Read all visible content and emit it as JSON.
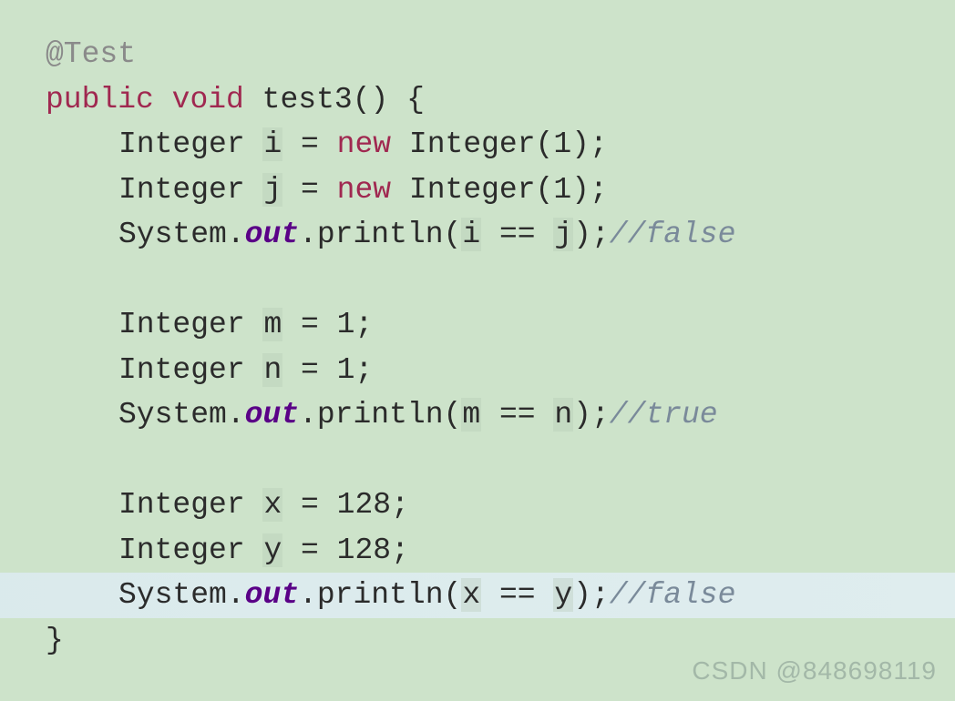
{
  "code": {
    "annotation": "@Test",
    "kw_public": "public",
    "kw_void": "void",
    "method_name": "test3",
    "brace_open": "{",
    "brace_close": "}",
    "type_integer": "Integer",
    "var_i": "i",
    "var_j": "j",
    "var_m": "m",
    "var_n": "n",
    "var_x": "x",
    "var_y": "y",
    "kw_new": "new",
    "num_1": "1",
    "num_128": "128",
    "system": "System",
    "out": "out",
    "println": "println",
    "eq_op": "==",
    "comment_false": "//false",
    "comment_true": "//true"
  },
  "watermark": "CSDN @848698119"
}
